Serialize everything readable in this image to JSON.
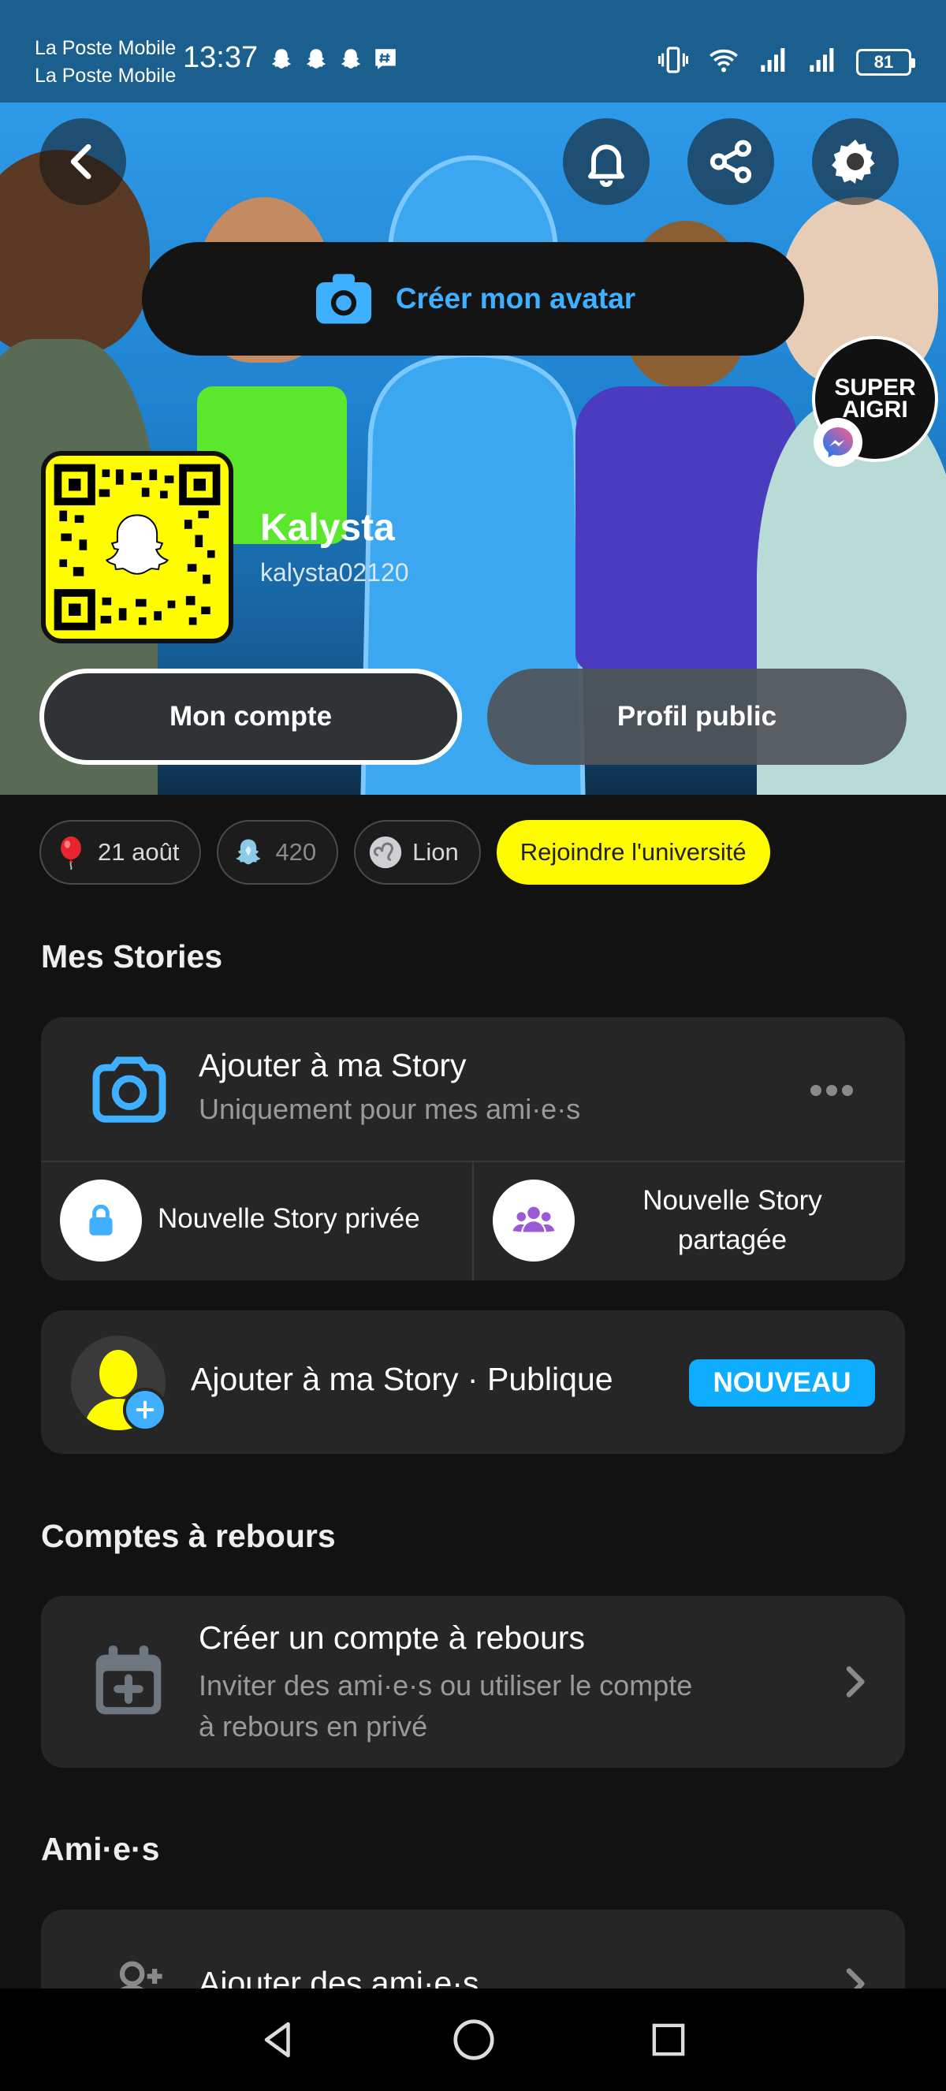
{
  "status_bar": {
    "carrier_1": "La Poste Mobile",
    "carrier_2": "La Poste Mobile",
    "time": "13:37",
    "battery": "81",
    "notification_icons": [
      "snapchat-ghost-icon",
      "snapchat-ghost-icon",
      "snapchat-ghost-icon",
      "hashtag-icon"
    ]
  },
  "header": {
    "create_avatar_label": "Créer mon avatar",
    "bitmoji_badge_text": "SUPER AIGRI",
    "profile_name": "Kalysta",
    "username": "kalysta02120",
    "my_account_button": "Mon compte",
    "public_profile_button": "Profil public"
  },
  "chips": [
    {
      "label": "21 août",
      "icon": "balloon-icon"
    },
    {
      "label": "420",
      "icon": "ghost-score-icon"
    },
    {
      "label": "Lion",
      "icon": "leo-zodiac-icon"
    },
    {
      "label": "Rejoindre l'université",
      "icon": ""
    }
  ],
  "stories": {
    "section_title": "Mes Stories",
    "add_story_title": "Ajouter à ma Story",
    "add_story_subtitle": "Uniquement pour mes ami·e·s",
    "private_story": "Nouvelle Story privée",
    "shared_story_line1": "Nouvelle Story",
    "shared_story_line2": "partagée",
    "public_story": "Ajouter à ma Story · Publique",
    "new_badge": "NOUVEAU"
  },
  "countdowns": {
    "section_title": "Comptes à rebours",
    "create_title": "Créer un compte à rebours",
    "create_sub_line1": "Inviter des ami·e·s ou utiliser le compte",
    "create_sub_line2": "à rebours en privé"
  },
  "friends": {
    "section_title": "Ami·e·s",
    "add_friends": "Ajouter des ami·e·s"
  },
  "colors": {
    "accent_blue": "#3eb0ff",
    "snap_yellow": "#fffc00",
    "card_bg": "#262626",
    "page_bg": "#121212"
  }
}
